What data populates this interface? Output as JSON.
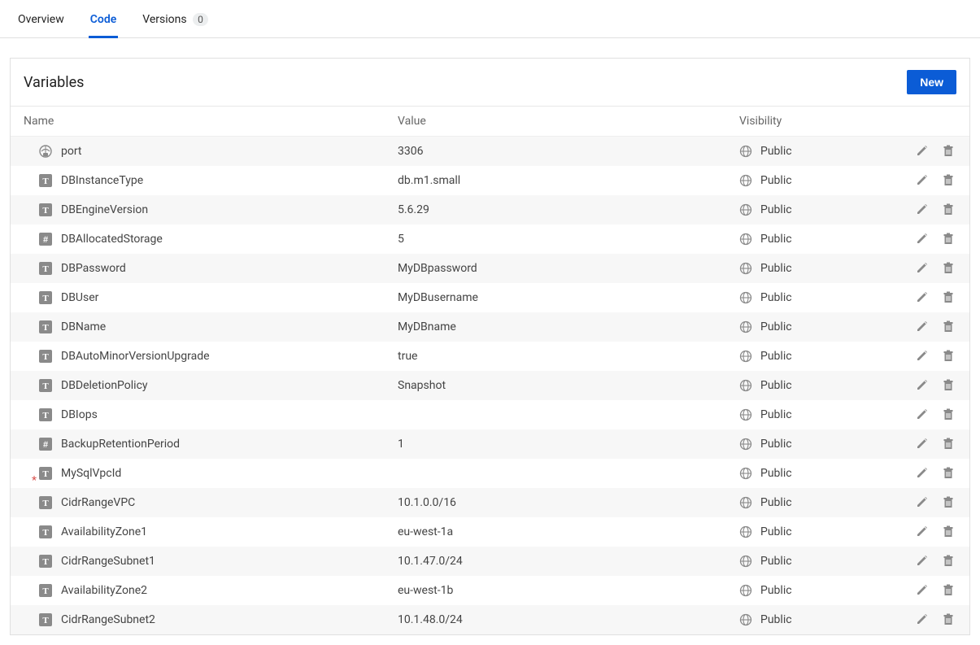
{
  "tabs": {
    "overview": "Overview",
    "code": "Code",
    "versions": "Versions",
    "versions_count": "0"
  },
  "panel": {
    "title": "Variables",
    "new_button": "New"
  },
  "columns": {
    "name": "Name",
    "value": "Value",
    "visibility": "Visibility"
  },
  "rows": [
    {
      "type": "port",
      "required": false,
      "name": "port",
      "value": "3306",
      "visibility": "Public"
    },
    {
      "type": "text",
      "required": false,
      "name": "DBInstanceType",
      "value": "db.m1.small",
      "visibility": "Public"
    },
    {
      "type": "text",
      "required": false,
      "name": "DBEngineVersion",
      "value": "5.6.29",
      "visibility": "Public"
    },
    {
      "type": "number",
      "required": false,
      "name": "DBAllocatedStorage",
      "value": "5",
      "visibility": "Public"
    },
    {
      "type": "text",
      "required": false,
      "name": "DBPassword",
      "value": "MyDBpassword",
      "visibility": "Public"
    },
    {
      "type": "text",
      "required": false,
      "name": "DBUser",
      "value": "MyDBusername",
      "visibility": "Public"
    },
    {
      "type": "text",
      "required": false,
      "name": "DBName",
      "value": "MyDBname",
      "visibility": "Public"
    },
    {
      "type": "text",
      "required": false,
      "name": "DBAutoMinorVersionUpgrade",
      "value": "true",
      "visibility": "Public"
    },
    {
      "type": "text",
      "required": false,
      "name": "DBDeletionPolicy",
      "value": "Snapshot",
      "visibility": "Public"
    },
    {
      "type": "text",
      "required": false,
      "name": "DBIops",
      "value": "",
      "visibility": "Public"
    },
    {
      "type": "number",
      "required": false,
      "name": "BackupRetentionPeriod",
      "value": "1",
      "visibility": "Public"
    },
    {
      "type": "text",
      "required": true,
      "name": "MySqlVpcId",
      "value": "",
      "visibility": "Public"
    },
    {
      "type": "text",
      "required": false,
      "name": "CidrRangeVPC",
      "value": "10.1.0.0/16",
      "visibility": "Public"
    },
    {
      "type": "text",
      "required": false,
      "name": "AvailabilityZone1",
      "value": "eu-west-1a",
      "visibility": "Public"
    },
    {
      "type": "text",
      "required": false,
      "name": "CidrRangeSubnet1",
      "value": "10.1.47.0/24",
      "visibility": "Public"
    },
    {
      "type": "text",
      "required": false,
      "name": "AvailabilityZone2",
      "value": "eu-west-1b",
      "visibility": "Public"
    },
    {
      "type": "text",
      "required": false,
      "name": "CidrRangeSubnet2",
      "value": "10.1.48.0/24",
      "visibility": "Public"
    }
  ]
}
